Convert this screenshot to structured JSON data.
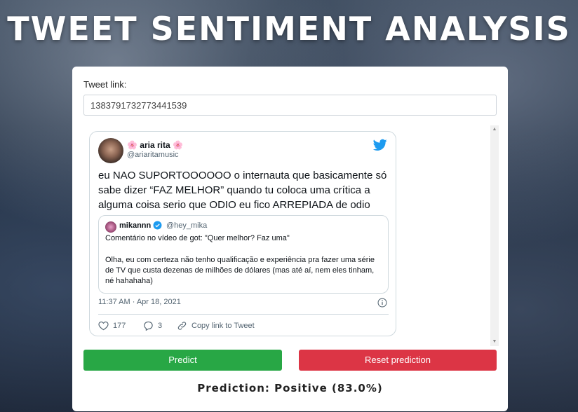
{
  "page": {
    "title": "TWEET SENTIMENT ANALYSIS"
  },
  "form": {
    "label": "Tweet link:",
    "value": "1383791732773441539"
  },
  "tweet": {
    "author": "🌸 aria rita 🌸",
    "handle": "@ariaritamusic",
    "text": "eu NAO SUPORTOOOOOO o internauta que basicamente só sabe dizer “FAZ MELHOR” quando tu coloca uma crítica a alguma coisa serio que ODIO eu fico ARREPIADA de odio",
    "quoted": {
      "author": "mikannn",
      "handle": "@hey_mika",
      "line1": "Comentário no vídeo de got: \"Quer melhor? Faz uma\"",
      "body": "Olha, eu com certeza não tenho qualificação e experiência pra fazer uma série de TV que custa dezenas de milhões de dólares (mas até aí, nem eles tinham, né hahahaha)"
    },
    "timestamp": "11:37 AM · Apr 18, 2021",
    "likes": "177",
    "replies": "3",
    "copy_link": "Copy link to Tweet"
  },
  "buttons": {
    "predict": "Predict",
    "reset": "Reset prediction"
  },
  "result": {
    "text": "Prediction: Positive (83.0%)"
  },
  "colors": {
    "predict": "#28a745",
    "reset": "#dc3545",
    "twitter": "#1d9bf0"
  }
}
